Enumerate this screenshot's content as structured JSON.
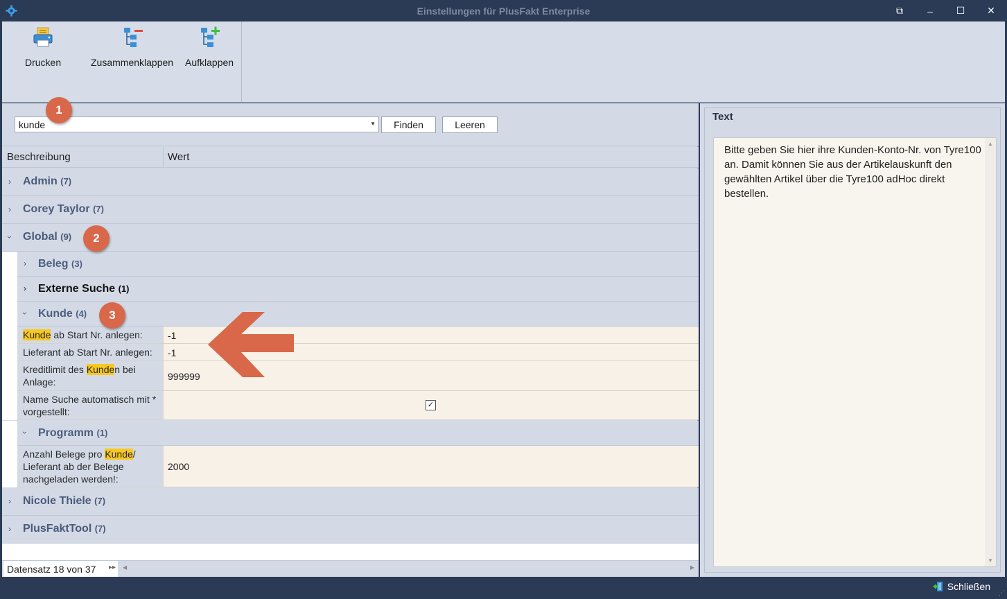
{
  "window": {
    "title": "Einstellungen für PlusFakt Enterprise",
    "controls": {
      "restore": "⧉",
      "minimize": "–",
      "maximize": "☐",
      "close": "✕"
    }
  },
  "toolbar": {
    "buttons": [
      {
        "label": "Drucken",
        "icon": "printer-icon"
      },
      {
        "label": "Zusammenklappen",
        "icon": "collapse-tree-icon"
      },
      {
        "label": "Aufklappen",
        "icon": "expand-tree-icon"
      }
    ]
  },
  "search": {
    "value": "kunde",
    "find_label": "Finden",
    "clear_label": "Leeren"
  },
  "annotations": {
    "badge1": "1",
    "badge2": "2",
    "badge3": "3",
    "arrow_color": "#d9674a"
  },
  "grid": {
    "col_description": "Beschreibung",
    "col_value": "Wert",
    "groups": [
      {
        "name": "Admin",
        "count": "(7)"
      },
      {
        "name": "Corey Taylor",
        "count": "(7)"
      },
      {
        "name": "Global",
        "count": "(9)"
      },
      {
        "name": "Nicole Thiele",
        "count": "(7)"
      },
      {
        "name": "PlusFaktTool",
        "count": "(7)"
      }
    ],
    "subgroups": [
      {
        "name": "Beleg",
        "count": "(3)"
      },
      {
        "name": "Externe Suche",
        "count": "(1)"
      },
      {
        "name": "Kunde",
        "count": "(4)"
      },
      {
        "name": "Programm",
        "count": "(1)"
      }
    ],
    "kunde_rows": [
      {
        "desc_hl": "Kunde",
        "desc_rest": " ab Start Nr. anlegen:",
        "value": "-1"
      },
      {
        "desc": "Lieferant ab Start Nr. anlegen:",
        "value": "-1"
      },
      {
        "desc_pre": "Kreditlimit des ",
        "desc_hl": "Kunde",
        "desc_rest": "n bei Anlage:",
        "value": "999999"
      },
      {
        "desc": "Name Suche automatisch mit * vorgestellt:",
        "value": "✓",
        "checked": true
      }
    ],
    "programm_rows": [
      {
        "desc_pre": "Anzahl Belege pro ",
        "desc_hl": "Kunde",
        "desc_rest": "/ Lieferant ab der Belege nachgeladen werden!:",
        "value": "2000"
      }
    ]
  },
  "footer": {
    "record_text": "Datensatz 18 von 37"
  },
  "text_panel": {
    "title": "Text",
    "content": "Bitte geben Sie hier ihre Kunden-Konto-Nr. von Tyre100 an. Damit können Sie aus der Artikelauskunft den gewählten Artikel über die Tyre100 adHoc direkt bestellen."
  },
  "statusbar": {
    "close_label": "Schließen"
  },
  "colors": {
    "title_bar": "#2b3a55",
    "ribbon": "#d6dde9",
    "highlight": "#f8c820",
    "row_bg": "#f8f1e8",
    "badge": "#d9674a"
  }
}
